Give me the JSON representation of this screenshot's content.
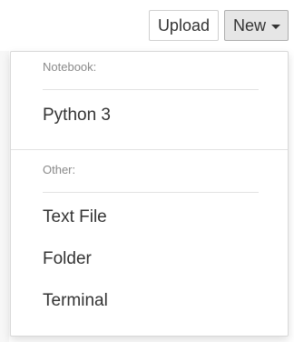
{
  "toolbar": {
    "upload_label": "Upload",
    "new_label": "New"
  },
  "menu": {
    "notebook_header": "Notebook:",
    "notebook_items": [
      {
        "label": "Python 3"
      }
    ],
    "other_header": "Other:",
    "other_items": [
      {
        "label": "Text File"
      },
      {
        "label": "Folder"
      },
      {
        "label": "Terminal"
      }
    ]
  },
  "icons": {
    "new_dropdown": "caret-down-icon"
  }
}
